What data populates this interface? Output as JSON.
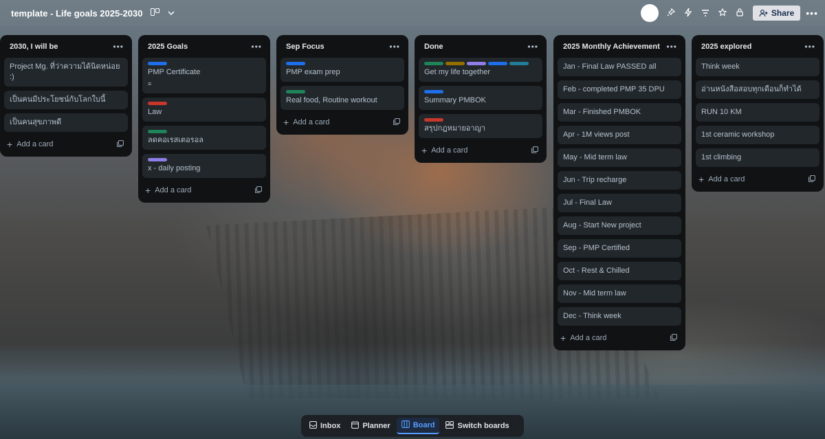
{
  "header": {
    "board_title": "template - Life goals 2025-2030",
    "share_label": "Share"
  },
  "colors": {
    "green": "#4bce97",
    "yellow": "#e2b203",
    "purple": "#9f8fef",
    "blue": "#579dff",
    "red": "#f87168",
    "sky": "#6cc3e0",
    "label_blue": "#1f6feb",
    "label_red": "#c9372c",
    "label_green": "#1f845a",
    "label_purple": "#8f7ee7",
    "label_teal": "#227d9b",
    "label_gold": "#946f00"
  },
  "lists": [
    {
      "title": "2030, I will be",
      "cards": [
        {
          "text": "Project Mg. ที่ว่าความได้นิดหน่อย :)"
        },
        {
          "text": "เป็นคนมีประโยชน์กับโลกใบนี้"
        },
        {
          "text": "เป็นคนสุขภาพดี"
        }
      ],
      "add_label": "Add a card"
    },
    {
      "title": "2025 Goals",
      "cards": [
        {
          "text": "PMP Certificate"
        },
        {
          "text": "Law"
        },
        {
          "text": "ลดคอเรสเตอรอล"
        },
        {
          "text": "x - daily posting"
        }
      ],
      "add_label": "Add a card"
    },
    {
      "title": "Sep Focus",
      "cards": [
        {
          "text": "PMP exam prep"
        },
        {
          "text": "Real food, Routine workout"
        }
      ],
      "add_label": "Add a card"
    },
    {
      "title": "Done",
      "cards": [
        {
          "text": "Get my life together"
        },
        {
          "text": "Summary PMBOK"
        },
        {
          "text": "สรุปกฎหมายอาญา"
        }
      ],
      "add_label": "Add a card"
    },
    {
      "title": "2025 Monthly Achievement",
      "cards": [
        {
          "text": "Jan - Final Law PASSED all"
        },
        {
          "text": "Feb - completed PMP 35 DPU"
        },
        {
          "text": "Mar - Finished PMBOK"
        },
        {
          "text": "Apr - 1M views post"
        },
        {
          "text": "May - Mid term law"
        },
        {
          "text": "Jun - Trip recharge"
        },
        {
          "text": "Jul - Final Law"
        },
        {
          "text": "Aug - Start New project"
        },
        {
          "text": "Sep - PMP Certified"
        },
        {
          "text": "Oct - Rest & Chilled"
        },
        {
          "text": "Nov - Mid term law"
        },
        {
          "text": "Dec - Think week"
        }
      ],
      "add_label": "Add a card"
    },
    {
      "title": "2025 explored",
      "cards": [
        {
          "text": "Think week"
        },
        {
          "text": "อ่านหนังสือสอบทุกเดือนก็ทำได้"
        },
        {
          "text": "RUN 10 KM"
        },
        {
          "text": "1st ceramic workshop"
        },
        {
          "text": "1st climbing"
        }
      ],
      "add_label": "Add a card"
    }
  ],
  "bottom_nav": {
    "inbox": "Inbox",
    "planner": "Planner",
    "board": "Board",
    "switch": "Switch boards"
  }
}
